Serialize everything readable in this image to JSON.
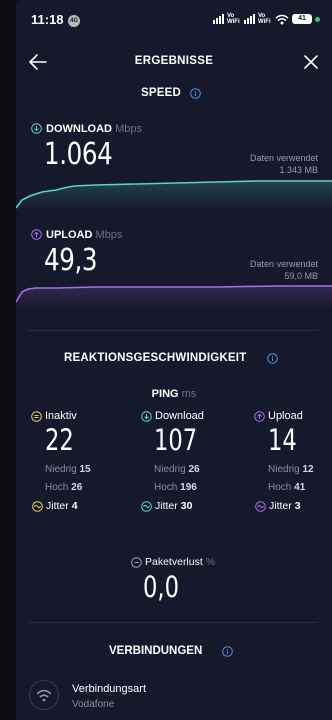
{
  "status_bar": {
    "time": "11:18",
    "badge": "4G",
    "vowifi_1": "Vo WiFi",
    "vowifi_2": "Vo WiFi",
    "battery": "41"
  },
  "header": {
    "title": "ERGEBNISSE"
  },
  "speed": {
    "title": "SPEED",
    "download": {
      "label": "DOWNLOAD",
      "unit": "Mbps",
      "value": "1.064",
      "data_caption": "Daten verwendet",
      "data_value": "1.343 MB"
    },
    "upload": {
      "label": "UPLOAD",
      "unit": "Mbps",
      "value": "49,3",
      "data_caption": "Daten verwendet",
      "data_value": "59,0 MB"
    }
  },
  "reaction": {
    "title": "REAKTIONSGESCHWINDIGKEIT",
    "ping_label": "PING",
    "ping_unit": "ms",
    "columns": [
      {
        "label": "Inaktiv",
        "value": "22",
        "low_label": "Niedrig",
        "low": "15",
        "high_label": "Hoch",
        "high": "26",
        "jitter_label": "Jitter",
        "jitter": "4"
      },
      {
        "label": "Download",
        "value": "107",
        "low_label": "Niedrig",
        "low": "26",
        "high_label": "Hoch",
        "high": "196",
        "jitter_label": "Jitter",
        "jitter": "30"
      },
      {
        "label": "Upload",
        "value": "14",
        "low_label": "Niedrig",
        "low": "12",
        "high_label": "Hoch",
        "high": "41",
        "jitter_label": "Jitter",
        "jitter": "3"
      }
    ],
    "packet_loss_label": "Paketverlust",
    "packet_loss_unit": "%",
    "packet_loss": "0,0"
  },
  "connections": {
    "title": "VERBINDUNGEN",
    "type_label": "Verbindungsart",
    "type_value": "Vodafone"
  },
  "colors": {
    "download": "#56d6c2",
    "upload": "#a86ee8",
    "idle": "#e8d25a",
    "info": "#4e8fe6",
    "background": "#16182b"
  }
}
